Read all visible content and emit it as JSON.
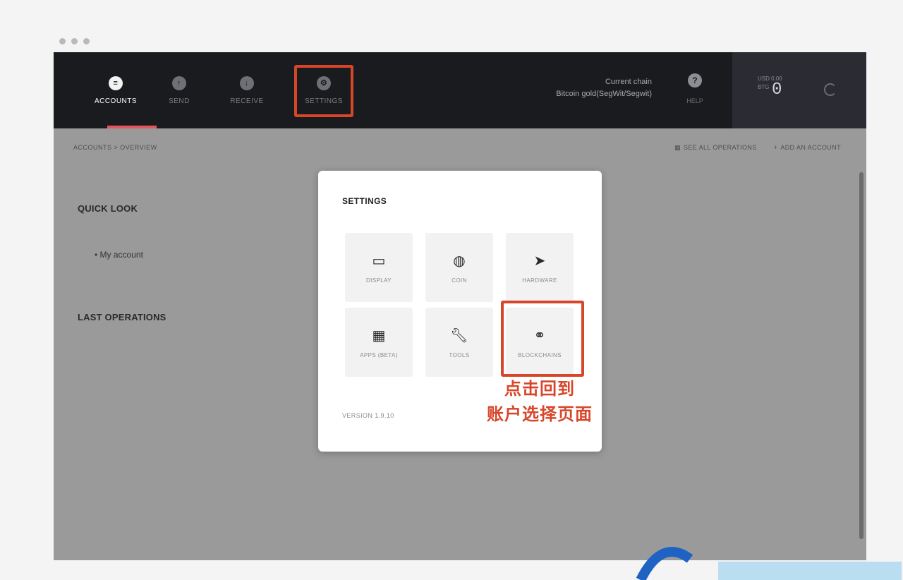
{
  "header": {
    "nav": [
      {
        "label": "ACCOUNTS",
        "icon": "accounts-icon",
        "active": true
      },
      {
        "label": "SEND",
        "icon": "send-icon",
        "active": false
      },
      {
        "label": "RECEIVE",
        "icon": "receive-icon",
        "active": false
      },
      {
        "label": "SETTINGS",
        "icon": "settings-icon",
        "active": false
      }
    ],
    "chain_label": "Current chain",
    "chain_value": "Bitcoin gold(SegWit/Segwit)",
    "help_label": "HELP",
    "balance": {
      "fiat_label": "USD 0.00",
      "crypto_label": "BTG",
      "value": "0"
    }
  },
  "breadcrumb": "ACCOUNTS > OVERVIEW",
  "actions": {
    "view_ops": "SEE ALL OPERATIONS",
    "add_account": "ADD AN ACCOUNT"
  },
  "left": {
    "quick_look": "QUICK LOOK",
    "account": "My account",
    "last_operations": "LAST OPERATIONS"
  },
  "modal": {
    "title": "SETTINGS",
    "tiles": [
      {
        "label": "DISPLAY",
        "icon": "monitor-icon"
      },
      {
        "label": "COIN",
        "icon": "globe-icon"
      },
      {
        "label": "HARDWARE",
        "icon": "rocket-icon"
      },
      {
        "label": "APPS (BETA)",
        "icon": "grid-icon"
      },
      {
        "label": "TOOLS",
        "icon": "wrench-icon"
      },
      {
        "label": "BLOCKCHAINS",
        "icon": "link-icon"
      }
    ],
    "version": "VERSION 1.9.10",
    "annotation": [
      "点击回到",
      "账户选择页面"
    ]
  },
  "colors": {
    "accent": "#e2575e",
    "highlight": "#d7462b",
    "topbar": "#1a1b1e",
    "overlay": "#9a9a9a"
  }
}
